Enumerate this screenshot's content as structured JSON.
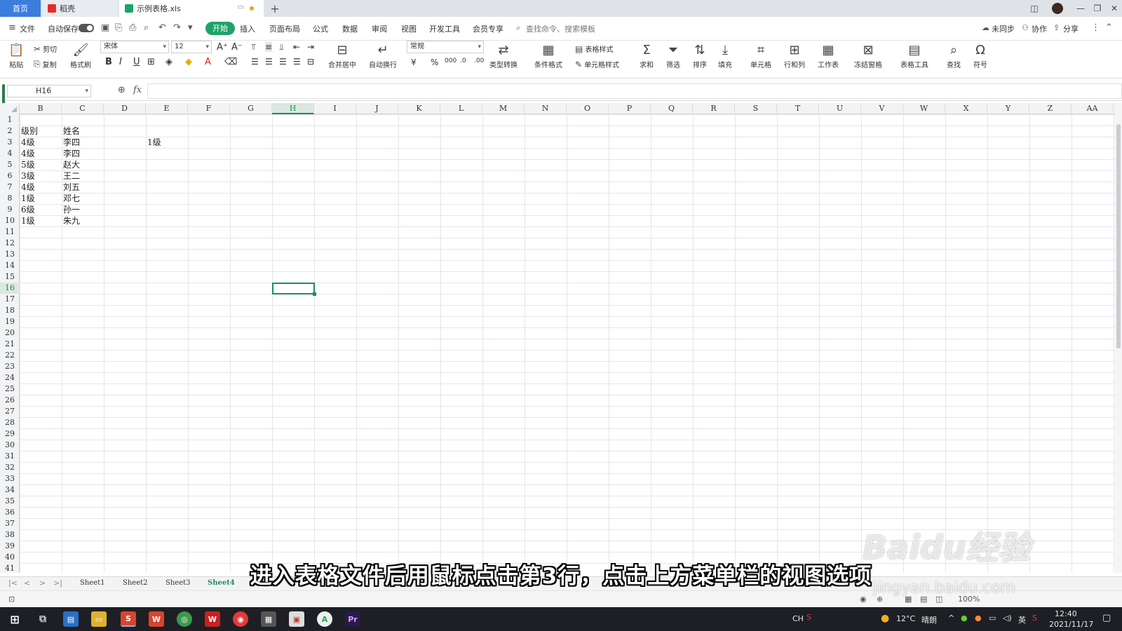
{
  "tabs": {
    "home": "首页",
    "daoke": "稻壳",
    "file": "示例表格.xls",
    "add": "+"
  },
  "menu": {
    "file": "文件",
    "autosave": "自动保存",
    "items": [
      "开始",
      "插入",
      "页面布局",
      "公式",
      "数据",
      "审阅",
      "视图",
      "开发工具",
      "会员专享"
    ],
    "active": "开始",
    "search_placeholder": "查找命令、搜索模板",
    "sync": "未同步",
    "collab": "协作",
    "share": "分享"
  },
  "ribbon": {
    "paste": "粘贴",
    "cut": "剪切",
    "copy": "复制",
    "format_painter": "格式刷",
    "font_name": "宋体",
    "font_size": "12",
    "merge_center": "合并居中",
    "wrap_text": "自动换行",
    "number_format": "常规",
    "type_convert": "类型转换",
    "conditional_format": "条件格式",
    "table_style": "表格样式",
    "cell_style": "单元格样式",
    "sum": "求和",
    "filter": "筛选",
    "sort": "排序",
    "fill": "填充",
    "cell": "单元格",
    "row_col": "行和列",
    "worksheet": "工作表",
    "freeze": "冻结窗格",
    "table_tools": "表格工具",
    "find": "查找",
    "symbol": "符号"
  },
  "formula_bar": {
    "name_box": "H16",
    "fx": "fx",
    "value": ""
  },
  "grid": {
    "columns": [
      "B",
      "C",
      "D",
      "E",
      "F",
      "G",
      "H",
      "I",
      "J",
      "K",
      "L",
      "M",
      "N",
      "O",
      "P",
      "Q",
      "R",
      "S",
      "T",
      "U",
      "V",
      "W",
      "X",
      "Y",
      "Z",
      "AA"
    ],
    "selected_column": "H",
    "selected_row": "16",
    "row_count": 42,
    "rows": [
      {
        "b": "级别",
        "c": "姓名"
      },
      {
        "b": "4级",
        "c": "李四",
        "e": "1级"
      },
      {
        "b": "4级",
        "c": "李四"
      },
      {
        "b": "5级",
        "c": "赵大"
      },
      {
        "b": "3级",
        "c": "王二"
      },
      {
        "b": "4级",
        "c": "刘五"
      },
      {
        "b": "1级",
        "c": "邓七"
      },
      {
        "b": "6级",
        "c": "孙一"
      },
      {
        "b": "1级",
        "c": "朱九"
      }
    ]
  },
  "sheets": [
    "Sheet1",
    "Sheet2",
    "Sheet3",
    "Sheet4"
  ],
  "active_sheet": "Sheet4",
  "status": {
    "zoom": "100%"
  },
  "taskbar": {
    "ime": "CH",
    "temperature": "12°C",
    "weather": "晴朗",
    "lang": "英",
    "time": "12:40",
    "date": "2021/11/17"
  },
  "caption": "进入表格文件后用鼠标点击第3行，点击上方菜单栏的视图选项",
  "watermark": "Baidu经验",
  "watermark_url": "jingyan.baidu.com",
  "colors": {
    "accent": "#1ea36a",
    "tab_blue": "#3b7ddd"
  }
}
